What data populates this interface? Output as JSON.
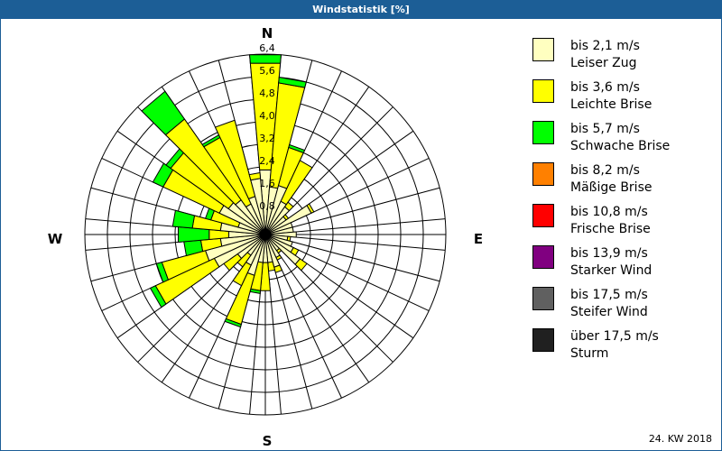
{
  "window": {
    "title": "Windstatistik [%]"
  },
  "footer": "24. KW 2018",
  "chart_data": {
    "type": "wind-rose",
    "title": "Windstatistik [%]",
    "unit": "%",
    "compass_labels": {
      "N": "N",
      "E": "E",
      "S": "S",
      "W": "W"
    },
    "ring_labels": [
      "0,8",
      "1,6",
      "2,4",
      "3,2",
      "4,0",
      "4,8",
      "5,6",
      "6,4"
    ],
    "rmax": 6.4,
    "ring_step": 0.8,
    "sector_width_deg": 10,
    "classes": [
      {
        "range": "bis 2,1 m/s",
        "name": "Leiser Zug",
        "color": "#ffffc0"
      },
      {
        "range": "bis 3,6 m/s",
        "name": "Leichte Brise",
        "color": "#ffff00"
      },
      {
        "range": "bis 5,7 m/s",
        "name": "Schwache Brise",
        "color": "#00ff00"
      },
      {
        "range": "bis 8,2 m/s",
        "name": "Mäßige Brise",
        "color": "#ff8000"
      },
      {
        "range": "bis 10,8 m/s",
        "name": "Frische Brise",
        "color": "#ff0000"
      },
      {
        "range": "bis 13,9 m/s",
        "name": "Starker Wind",
        "color": "#800080"
      },
      {
        "range": "bis 17,5 m/s",
        "name": "Steifer Wind",
        "color": "#606060"
      },
      {
        "range": "über 17,5 m/s",
        "name": "Sturm",
        "color": "#202020"
      }
    ],
    "sectors": [
      {
        "dir": 0,
        "values": [
          2.3,
          3.8,
          0.3
        ]
      },
      {
        "dir": 10,
        "values": [
          1.7,
          3.7,
          0.2
        ]
      },
      {
        "dir": 20,
        "values": [
          1.8,
          1.4,
          0.1
        ]
      },
      {
        "dir": 30,
        "values": [
          1.3,
          1.6,
          0
        ]
      },
      {
        "dir": 40,
        "values": [
          1.2,
          0.2,
          0
        ]
      },
      {
        "dir": 50,
        "values": [
          0.9,
          0.1,
          0
        ]
      },
      {
        "dir": 60,
        "values": [
          1.8,
          0.1,
          0
        ]
      },
      {
        "dir": 70,
        "values": [
          1.0,
          0,
          0
        ]
      },
      {
        "dir": 80,
        "values": [
          1.0,
          0,
          0
        ]
      },
      {
        "dir": 90,
        "values": [
          1.1,
          0,
          0
        ]
      },
      {
        "dir": 100,
        "values": [
          0.8,
          0.1,
          0
        ]
      },
      {
        "dir": 110,
        "values": [
          1.0,
          0,
          0
        ]
      },
      {
        "dir": 120,
        "values": [
          1.1,
          0.2,
          0
        ]
      },
      {
        "dir": 130,
        "values": [
          1.5,
          0.3,
          0
        ]
      },
      {
        "dir": 140,
        "values": [
          0.7,
          0.1,
          0
        ]
      },
      {
        "dir": 150,
        "values": [
          0.9,
          0.1,
          0
        ]
      },
      {
        "dir": 160,
        "values": [
          1.2,
          0.2,
          0
        ]
      },
      {
        "dir": 170,
        "values": [
          1.0,
          0.3,
          0
        ]
      },
      {
        "dir": 180,
        "values": [
          1.0,
          1.0,
          0
        ]
      },
      {
        "dir": 190,
        "values": [
          1.0,
          1.0,
          0.1
        ]
      },
      {
        "dir": 200,
        "values": [
          1.5,
          1.8,
          0.1
        ]
      },
      {
        "dir": 210,
        "values": [
          1.2,
          0.8,
          0
        ]
      },
      {
        "dir": 220,
        "values": [
          0.9,
          0.5,
          0
        ]
      },
      {
        "dir": 230,
        "values": [
          1.2,
          0.6,
          0
        ]
      },
      {
        "dir": 240,
        "values": [
          2.0,
          2.3,
          0.2
        ]
      },
      {
        "dir": 250,
        "values": [
          2.2,
          1.6,
          0.2
        ]
      },
      {
        "dir": 260,
        "values": [
          1.6,
          0.7,
          0.6
        ]
      },
      {
        "dir": 270,
        "values": [
          1.3,
          0.7,
          1.1
        ]
      },
      {
        "dir": 280,
        "values": [
          1.6,
          1.0,
          0.7
        ]
      },
      {
        "dir": 290,
        "values": [
          1.0,
          1.0,
          0.2
        ]
      },
      {
        "dir": 300,
        "values": [
          1.8,
          2.2,
          0.4
        ]
      },
      {
        "dir": 310,
        "values": [
          1.6,
          2.5,
          0.2
        ]
      },
      {
        "dir": 320,
        "values": [
          1.5,
          3.5,
          1.2
        ]
      },
      {
        "dir": 330,
        "values": [
          1.2,
          2.6,
          0.1
        ]
      },
      {
        "dir": 340,
        "values": [
          1.4,
          2.8,
          0
        ]
      },
      {
        "dir": 350,
        "values": [
          2.0,
          0.2,
          0
        ]
      }
    ]
  }
}
